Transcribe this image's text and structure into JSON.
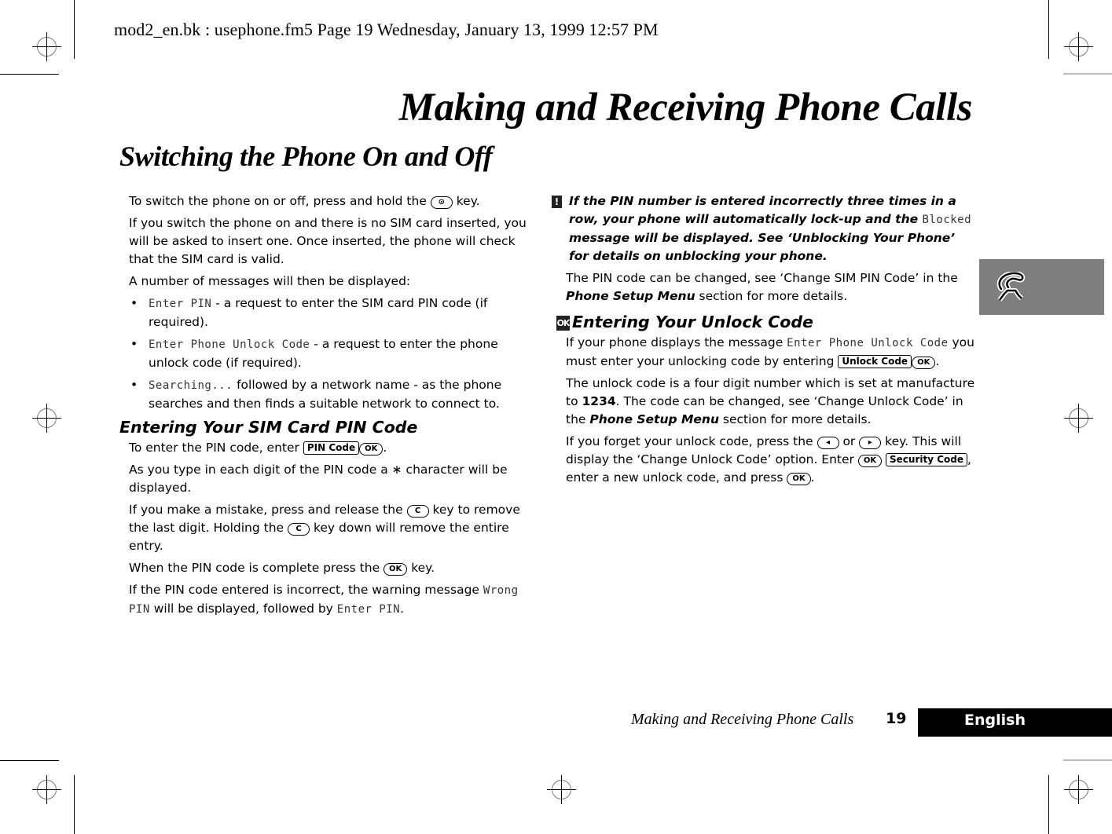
{
  "slug": "mod2_en.bk : usephone.fm5  Page 19  Wednesday, January 13, 1999  12:57 PM",
  "chapter_title": "Making and Receiving Phone Calls",
  "section_title": "Switching the Phone On and Off",
  "left": {
    "p1_a": "To switch the phone on or off, press and hold the ",
    "p1_key": "⊙",
    "p1_b": " key.",
    "p2": "If you switch the phone on and there is no SIM card inserted, you will be asked to insert one. Once inserted, the phone will check that the SIM card is valid.",
    "p3": "A number of messages will then be displayed:",
    "bullets": [
      {
        "lcd": "Enter PIN",
        "text": " - a request to enter the SIM card PIN code (if required)."
      },
      {
        "lcd": "Enter Phone Unlock Code",
        "text": " - a request to enter the phone unlock code (if required)."
      },
      {
        "lcd": "Searching...",
        "text": " followed by a network name - as the phone searches and then finds a suitable network to connect to."
      }
    ],
    "bullet_char": "•",
    "sub_heading": "Entering Your SIM Card PIN Code",
    "p4_a": "To enter the PIN code, enter ",
    "p4_key1": "PIN Code",
    "p4_key2": "OK",
    "p4_b": ".",
    "p5": "As you type in each digit of the PIN code a ∗ character will be displayed.",
    "p6_a": "If you make a mistake, press and release the ",
    "p6_key": "C",
    "p6_b": " key to remove the last digit. Holding the ",
    "p6_c": " key down will remove the entire entry.",
    "p7_a": "When the PIN code is complete press the ",
    "p7_key": "OK",
    "p7_b": " key.",
    "p8_a": "If the PIN code entered is incorrect, the warning message ",
    "p8_lcd1": "Wrong PIN",
    "p8_b": " will be displayed, followed by ",
    "p8_lcd2": "Enter PIN",
    "p8_c": "."
  },
  "right": {
    "note_icon": "!",
    "note_a": "If the PIN number is entered incorrectly three times in a row, your phone will automatically lock-up and the ",
    "note_lcd": "Blocked",
    "note_b": " message will be displayed. See ‘Unblocking Your Phone’ for details on unblocking your phone.",
    "p1_a": "The PIN code can be changed, see ‘Change SIM PIN Code’ in the ",
    "p1_bi": "Phone Setup Menu",
    "p1_b": " section for more details.",
    "sub_heading_icon": "OK",
    "sub_heading": "Entering Your Unlock Code",
    "p2_a": "If your phone displays the message ",
    "p2_lcd": "Enter Phone Unlock Code",
    "p2_b": " you must enter your unlocking code by entering ",
    "p2_key1": "Unlock Code",
    "p2_key2": "OK",
    "p2_c": ".",
    "p3_a": "The unlock code is a four digit number which is set at manufacture to ",
    "p3_bold": "1234",
    "p3_b": ". The code can be changed, see ‘Change Unlock Code’ in the ",
    "p3_bi": "Phone Setup Menu",
    "p3_c": " section for more details.",
    "p4_a": "If you forget your unlock code, press the ",
    "p4_key1": "◂",
    "p4_b": " or ",
    "p4_key2": "▸",
    "p4_c": " key. This will display the ‘Change Unlock Code’ option. Enter ",
    "p4_key3": "OK",
    "p4_key4": "Security Code",
    "p4_d": ", enter a new unlock code, and press ",
    "p4_key5": "OK",
    "p4_e": "."
  },
  "tab_icon": "phone-handset-icon",
  "footer": {
    "running_title": "Making and Receiving Phone Calls",
    "page_number": "19",
    "language": "English"
  }
}
